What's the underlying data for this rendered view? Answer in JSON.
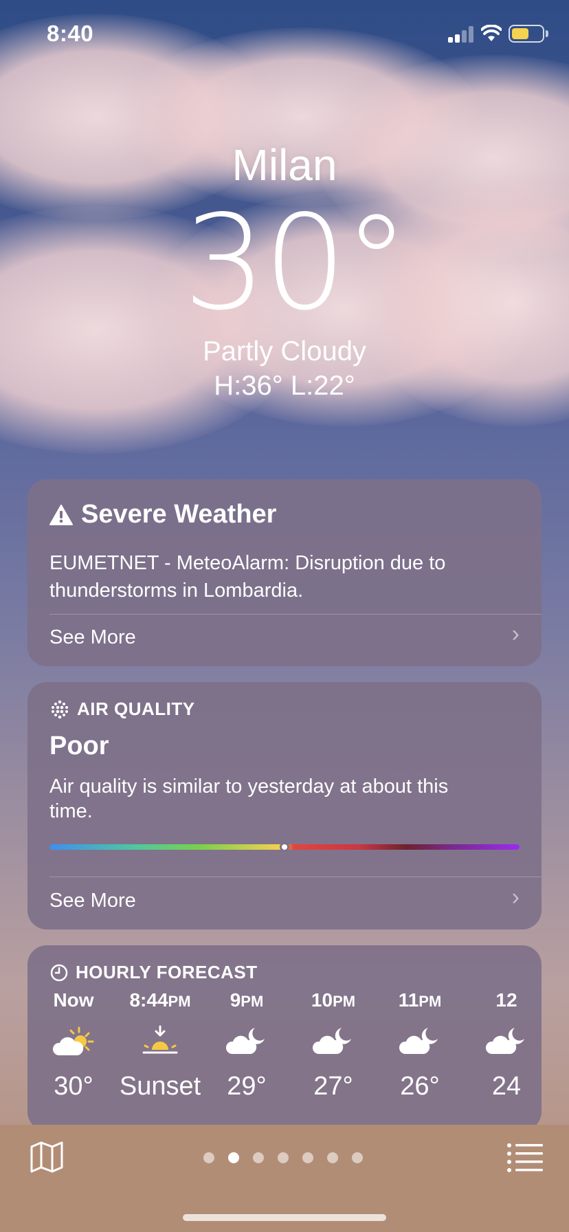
{
  "status": {
    "time": "8:40"
  },
  "hero": {
    "city": "Milan",
    "temperature": "30°",
    "condition": "Partly Cloudy",
    "hilo": "H:36°  L:22°"
  },
  "severe": {
    "title": "Severe Weather",
    "text": "EUMETNET - MeteoAlarm: Disruption due to thunderstorms in Lombardia.",
    "see_more": "See More"
  },
  "air_quality": {
    "label": "AIR QUALITY",
    "value": "Poor",
    "text": "Air quality is similar to yesterday at about this time.",
    "level_fraction": 0.5,
    "see_more": "See More"
  },
  "hourly": {
    "label": "HOURLY FORECAST",
    "items": [
      {
        "time": "Now",
        "suffix": "",
        "icon": "sun-cloud-icon",
        "temp": "30°"
      },
      {
        "time": "8:44",
        "suffix": "PM",
        "icon": "sunset-icon",
        "temp": "Sunset"
      },
      {
        "time": "9",
        "suffix": "PM",
        "icon": "cloud-moon-icon",
        "temp": "29°"
      },
      {
        "time": "10",
        "suffix": "PM",
        "icon": "cloud-moon-icon",
        "temp": "27°"
      },
      {
        "time": "11",
        "suffix": "PM",
        "icon": "cloud-moon-icon",
        "temp": "26°"
      },
      {
        "time": "12",
        "suffix": "",
        "icon": "cloud-moon-icon",
        "temp": "24"
      }
    ]
  },
  "pager": {
    "count": 7,
    "current": 1
  },
  "colors": {
    "sun": "#f6c945",
    "card": "#7d7088"
  }
}
